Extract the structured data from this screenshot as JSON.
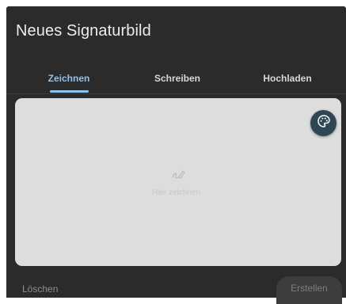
{
  "dialog": {
    "title": "Neues Signaturbild"
  },
  "tabs": [
    {
      "label": "Zeichnen",
      "active": true
    },
    {
      "label": "Schreiben",
      "active": false
    },
    {
      "label": "Hochladen",
      "active": false
    }
  ],
  "canvas": {
    "placeholder": "Hier zeichnen",
    "placeholder_icon": "draw-icon",
    "palette_icon": "palette-icon"
  },
  "footer": {
    "delete_label": "Löschen",
    "create_label": "Erstellen"
  },
  "colors": {
    "accent": "#8fc3ee",
    "dialog_bg": "#2b2b2b",
    "canvas_bg": "#dddddd",
    "palette_button_bg": "#2f4655"
  }
}
